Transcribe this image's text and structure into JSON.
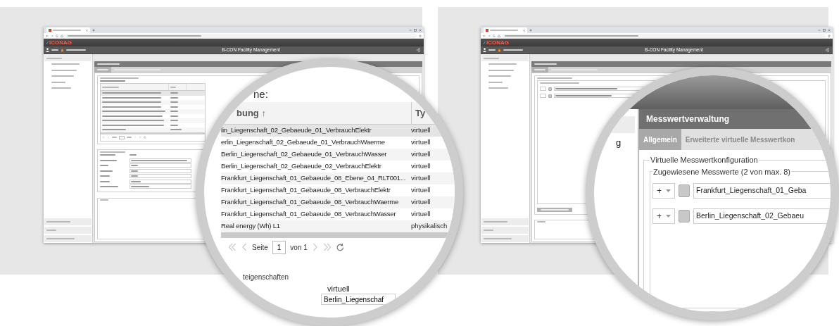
{
  "left_window": {
    "logo": "ICONAG",
    "app_title": "B-CON Facility Management"
  },
  "right_window": {
    "logo": "ICONAG",
    "app_title": "B-CON Facility Management"
  },
  "left_magnifier": {
    "title": "ne:",
    "column_1": "bung ↑",
    "column_2": "Ty",
    "rows": [
      [
        "lin_Liegenschaft_02_Gebaeude_01_VerbrauchElektr",
        "virtuell"
      ],
      [
        "erlin_Liegenschaft_02_Gebaeude_01_VerbrauchWaerme",
        "virtuell"
      ],
      [
        "Berlin_Liegenschaft_02_Gebaeude_01_VerbrauchWasser",
        "virtuell"
      ],
      [
        "Berlin_Liegenschaft_02_Gebaeude_02_VerbrauchElektr",
        "virtuell"
      ],
      [
        "Frankfurt_Liegenschaft_01_Gebaeude_08_Ebene_04_RLT001...",
        "virtuell"
      ],
      [
        "Frankfurt_Liegenschaft_01_Gebaeude_08_VerbrauchElektr",
        "virtuell"
      ],
      [
        "Frankfurt_Liegenschaft_01_Gebaeude_08_VerbrauchWaerme",
        "virtuell"
      ],
      [
        "Frankfurt_Liegenschaft_01_Gebaeude_08_VerbrauchWasser",
        "virtuell"
      ],
      [
        "Real energy (Wh) L1",
        "physikalisch"
      ]
    ],
    "pager": {
      "page_label": "Seite",
      "page": "1",
      "page_count": "von 1"
    },
    "legend": "teigenschaften",
    "value": "virtuell",
    "field": "Berlin_Liegenschaf"
  },
  "right_magnifier": {
    "sidebar_fragment": "g",
    "panel_title": "Messwertverwaltung",
    "tabs": [
      {
        "label": "Allgemein",
        "selected": true
      },
      {
        "label": "Erweiterte virtuelle Messwertkon",
        "selected": false
      }
    ],
    "legend": "Virtuelle Messwertkonfiguration",
    "assigned_legend": "Zugewiesene Messwerte (2 von max. 8)",
    "rows": [
      {
        "add": "+",
        "value": "Frankfurt_Liegenschaft_01_Geba"
      },
      {
        "add": "+",
        "value": "Berlin_Liegenschaft_02_Gebaeu"
      }
    ]
  }
}
